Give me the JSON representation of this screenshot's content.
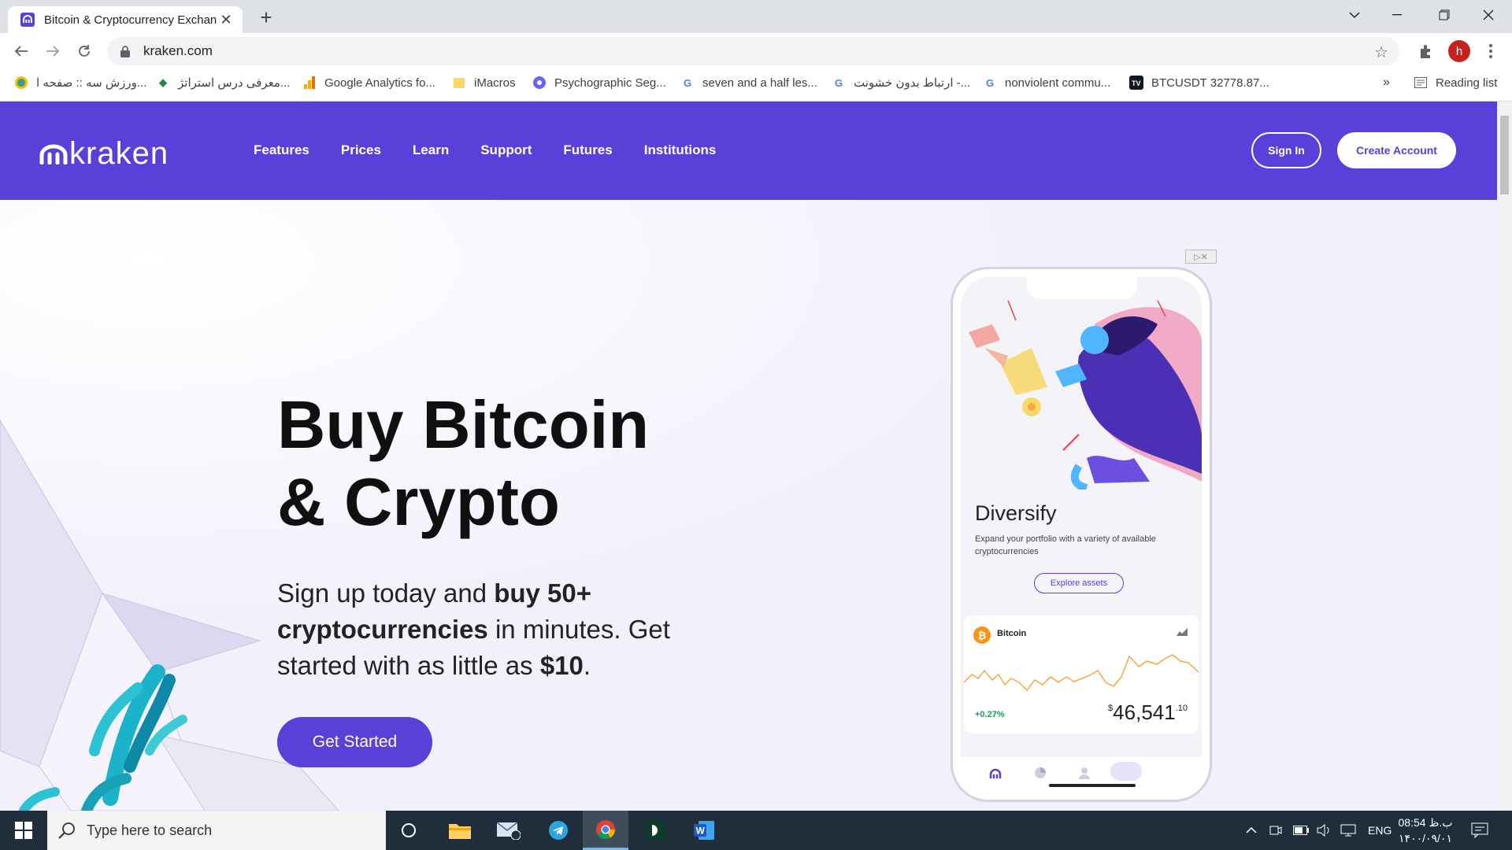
{
  "browser": {
    "tab_title": "Bitcoin & Cryptocurrency Exchan",
    "tab_close": "✕",
    "new_tab": "+",
    "url": "kraken.com",
    "reading_list": "Reading list",
    "more_bookmarks": "»",
    "profile_initial": "h",
    "bookmarks": [
      {
        "label": "ورزش سه :: صفحه ا...",
        "icon": "varzesh3-icon"
      },
      {
        "label": "معرفی درس استراتژ...",
        "icon": "bookmark-icon"
      },
      {
        "label": "Google Analytics fo...",
        "icon": "analytics-icon"
      },
      {
        "label": "iMacros",
        "icon": "folder-icon"
      },
      {
        "label": "Psychographic Seg...",
        "icon": "site-icon"
      },
      {
        "label": "seven and a half les...",
        "icon": "google-icon"
      },
      {
        "label": "ارتباط بدون خشونت -...",
        "icon": "google-icon"
      },
      {
        "label": "nonviolent commu...",
        "icon": "google-icon"
      },
      {
        "label": "BTCUSDT 32778.87...",
        "icon": "tradingview-icon"
      }
    ]
  },
  "site": {
    "logo": "kraken",
    "nav": [
      "Features",
      "Prices",
      "Learn",
      "Support",
      "Futures",
      "Institutions"
    ],
    "sign_in": "Sign In",
    "create_account": "Create Account",
    "colors": {
      "brand": "#5741d9",
      "hero_bg": "#f2f0fb"
    }
  },
  "hero": {
    "headline_line1": "Buy Bitcoin",
    "headline_line2": "& Crypto",
    "sub_part1": "Sign up today and ",
    "sub_bold1": "buy 50+ cryptocurrencies",
    "sub_part2": " in minutes. Get started with as little as ",
    "sub_bold2": "$10",
    "sub_part3": ".",
    "cta": "Get Started"
  },
  "phone": {
    "title": "Diversify",
    "text": "Expand your portfolio with a variety of available cryptocurrencies",
    "button": "Explore assets",
    "coin_name": "Bitcoin",
    "coin_symbol": "₿",
    "change": "+0.27%",
    "price_currency": "$",
    "price_main": "46,541",
    "price_cents": ".10"
  },
  "taskbar": {
    "search_placeholder": "Type here to search",
    "language": "ENG",
    "time": "08:54 ب.ظ",
    "date": "۱۴۰۰/۰۹/۰۱"
  }
}
